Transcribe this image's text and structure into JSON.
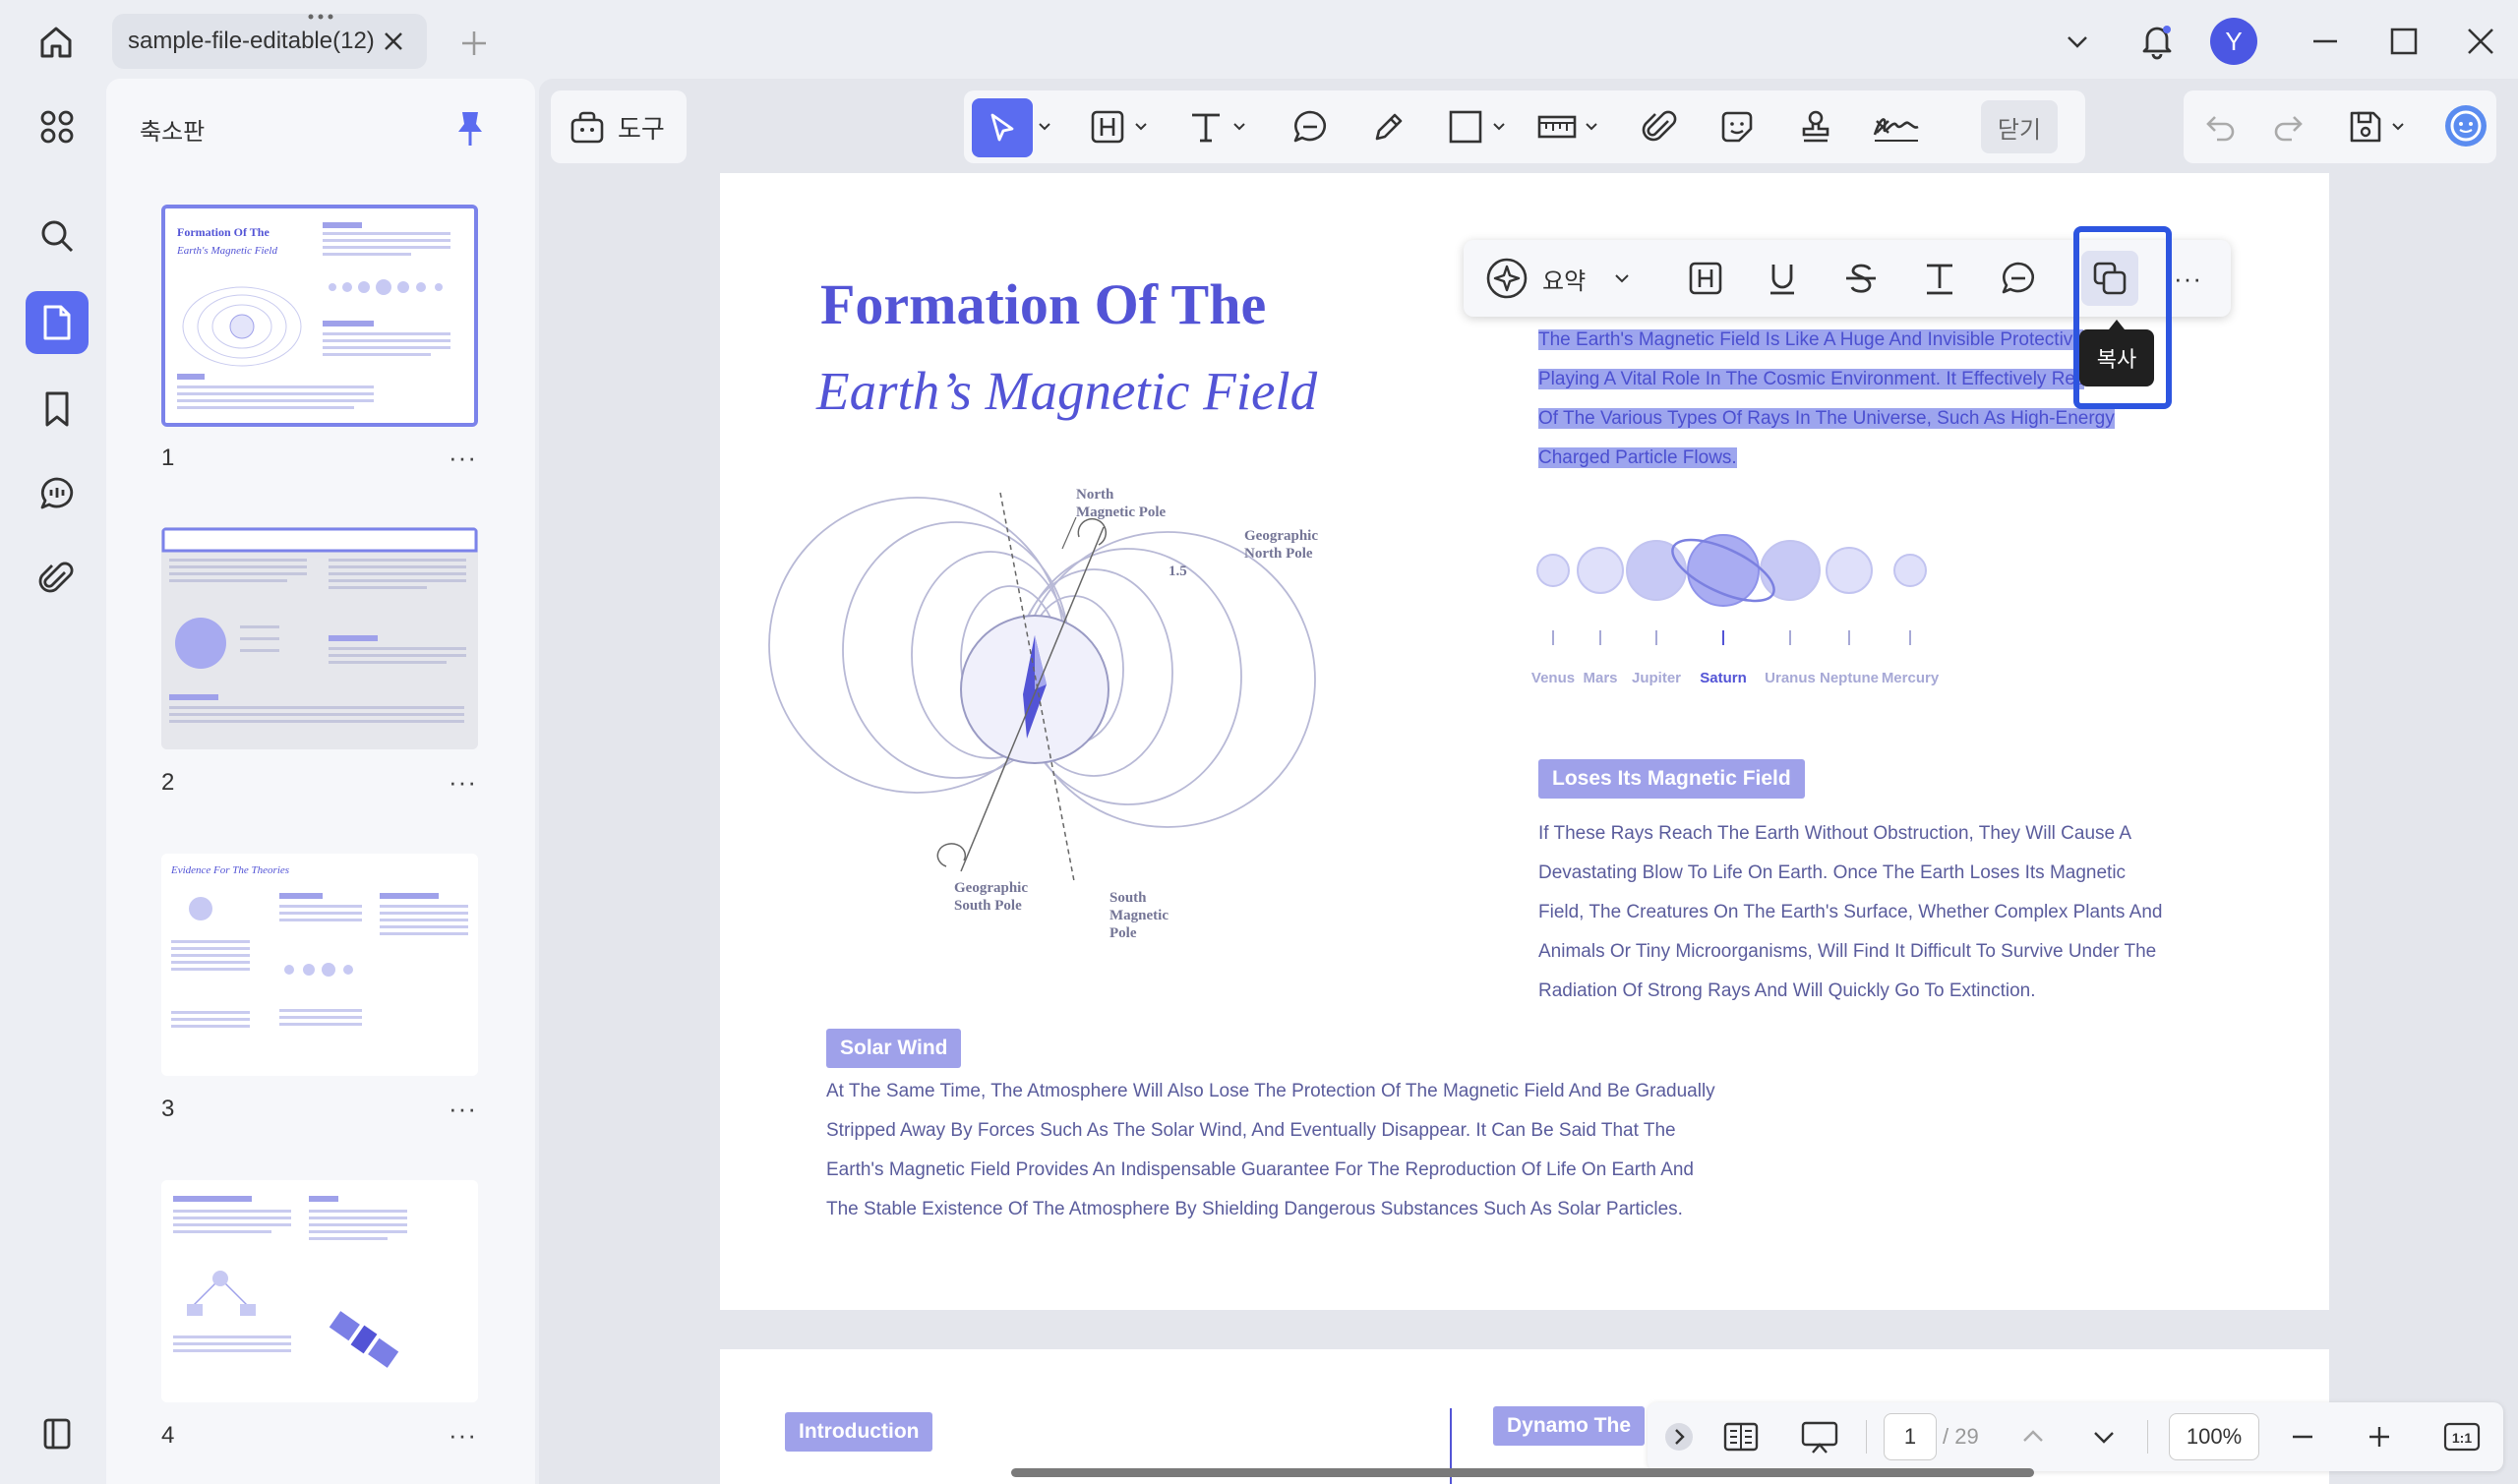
{
  "window": {
    "tab_title": "sample-file-editable(12)",
    "avatar_initial": "Y"
  },
  "sidebar": {
    "panel_title": "축소판",
    "thumbnails": [
      {
        "page": "1",
        "title_line1": "Formation Of The",
        "title_line2": "Earth's Magnetic Field"
      },
      {
        "page": "2"
      },
      {
        "page": "3",
        "title": "Evidence For The Theories"
      },
      {
        "page": "4"
      }
    ],
    "more_label": "···"
  },
  "toolbar": {
    "tools_label": "도구",
    "close_label": "닫기"
  },
  "float_toolbar": {
    "summarize_label": "요약",
    "copy_tooltip": "복사",
    "more_label": "···"
  },
  "page1": {
    "title_line1": "Formation Of The",
    "title_line2": "Earth’s Magnetic Field",
    "intro_lines": [
      "The Earth's Magnetic Field Is Like A Huge And Invisible Protective",
      "Playing A Vital Role In The Cosmic Environment. It Effectively Res",
      "Of The Various Types Of Rays In The Universe, Such As High-Energy",
      "Charged Particle Flows."
    ],
    "planets": [
      "Venus",
      "Mars",
      "Jupiter",
      "Saturn",
      "Uranus",
      "Neptune",
      "Mercury"
    ],
    "diagram_labels": {
      "north_magnetic": "North\nMagnetic Pole",
      "geo_north": "Geographic\nNorth Pole",
      "geo_south": "Geographic\nSouth Pole",
      "south_magnetic": "South\nMagnetic\nPole",
      "angle": "1.5"
    },
    "section1_badge": "Loses Its Magnetic Field",
    "section1_lines": [
      "If These Rays Reach The Earth Without Obstruction, They Will Cause A",
      "Devastating Blow To Life On Earth. Once The Earth Loses Its Magnetic",
      "Field, The Creatures On The Earth's Surface, Whether Complex Plants And",
      "Animals Or Tiny Microorganisms, Will Find It Difficult To Survive Under The",
      "Radiation Of Strong Rays And Will Quickly Go To Extinction."
    ],
    "section2_badge": "Solar Wind",
    "section2_lines": [
      "At The Same Time, The Atmosphere Will Also Lose The Protection Of The Magnetic Field And Be Gradually",
      "Stripped Away By Forces Such As The Solar Wind, And Eventually Disappear. It Can Be Said That The",
      "Earth's Magnetic Field Provides An Indispensable Guarantee For The Reproduction Of Life On Earth And",
      "The Stable Existence Of The Atmosphere By Shielding Dangerous Substances Such As Solar Particles."
    ]
  },
  "page2": {
    "badge_left": "Introduction",
    "badge_right": "Dynamo The"
  },
  "bottom_nav": {
    "current_page": "1",
    "total_pages": "/ 29",
    "zoom": "100%"
  },
  "colors": {
    "accent": "#5b6cf0",
    "title_blue": "#5354d6",
    "selection": "#9da5ee",
    "highlight_box": "#2d55e0"
  }
}
